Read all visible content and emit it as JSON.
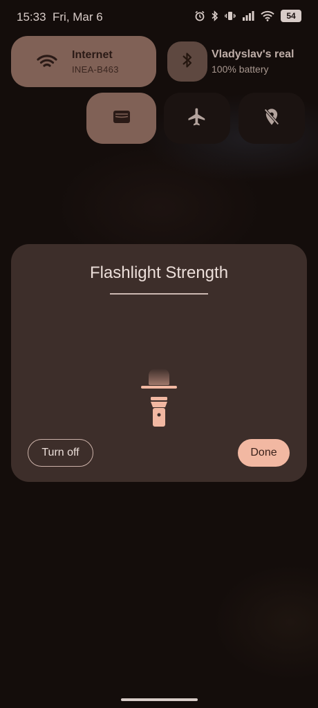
{
  "status_bar": {
    "time": "15:33",
    "date": "Fri, Mar 6",
    "battery": "54",
    "icons": [
      "alarm-icon",
      "bluetooth-icon",
      "vibrate-icon",
      "signal-icon",
      "wifi-icon",
      "battery-icon"
    ]
  },
  "quick_settings": {
    "internet": {
      "title": "Internet",
      "subtitle": "INEA-B463",
      "icon": "wifi-icon"
    },
    "bluetooth": {
      "title": "Vladyslav's real",
      "subtitle": "100% battery",
      "icon": "bluetooth-icon"
    },
    "tiles": [
      {
        "icon": "wallet-icon",
        "active": true
      },
      {
        "icon": "airplane-icon",
        "active": false
      },
      {
        "icon": "location-off-icon",
        "active": false
      }
    ]
  },
  "dialog": {
    "title": "Flashlight Strength",
    "turn_off_label": "Turn off",
    "done_label": "Done",
    "icon": "flashlight-icon"
  },
  "colors": {
    "accent": "#f2b8a2",
    "tile_active": "#806156",
    "dialog_bg": "#3d2e2a",
    "background": "#140d0b"
  }
}
